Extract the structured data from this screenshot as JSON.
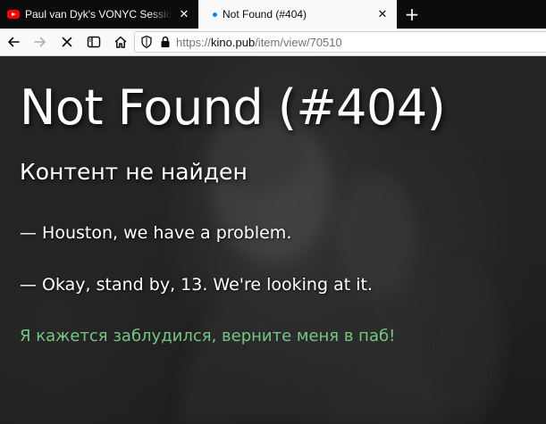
{
  "browser": {
    "tabs": [
      {
        "title": "Paul van Dyk's VONYC Sessions",
        "icon": "youtube-icon",
        "active": false
      },
      {
        "title": "Not Found (#404)",
        "icon": "loading-dot-icon",
        "active": true
      }
    ],
    "new_tab_symbol": "+",
    "close_symbol": "✕",
    "url": {
      "scheme": "https://",
      "host": "kino.pub",
      "path": "/item/view/70510"
    }
  },
  "page": {
    "heading": "Not Found (#404)",
    "subheading": "Контент не найден",
    "quote1": "— Houston, we have a problem.",
    "quote2": "— Okay, stand by, 13. We're looking at it.",
    "link_text": "Я кажется заблудился, верните меня в паб!"
  },
  "colors": {
    "link": "#76c585",
    "tab_accent": "#0a84ff",
    "youtube": "#ff0000"
  }
}
